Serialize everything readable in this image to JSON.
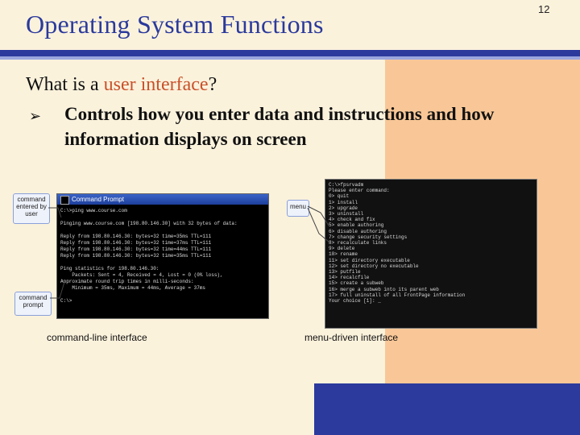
{
  "slide": {
    "title": "Operating System Functions",
    "page_number": "12",
    "question_prefix": "What is a ",
    "question_highlight": "user interface",
    "question_suffix": "?",
    "bullet_marker": "➢",
    "bullet_text": "Controls how you enter data and instructions and how information displays on screen"
  },
  "figures": {
    "command_line": {
      "window_title": "Command Prompt",
      "lines": [
        "C:\\>ping www.course.com",
        "",
        "Pinging www.course.com [198.80.146.30] with 32 bytes of data:",
        "",
        "Reply from 198.80.146.30: bytes=32 time=35ms TTL=111",
        "Reply from 198.80.146.30: bytes=32 time=37ms TTL=111",
        "Reply from 198.80.146.30: bytes=32 time=44ms TTL=111",
        "Reply from 198.80.146.30: bytes=32 time=35ms TTL=111",
        "",
        "Ping statistics for 198.80.146.30:",
        "    Packets: Sent = 4, Received = 4, Lost = 0 (0% loss),",
        "Approximate round trip times in milli-seconds:",
        "    Minimum = 35ms, Maximum = 44ms, Average = 37ms",
        "",
        "C:\\>"
      ],
      "callout_entered": "command entered by user",
      "callout_prompt": "command prompt",
      "caption": "command-line interface"
    },
    "menu_driven": {
      "lines": [
        "C:\\>fpsrvadm",
        "Please enter command:",
        "0> quit",
        "1> install",
        "2> upgrade",
        "3> uninstall",
        "4> check and fix",
        "5> enable authoring",
        "6> disable authoring",
        "7> change security settings",
        "8> recalculate links",
        "9> delete",
        "10> rename",
        "11> set directory executable",
        "12> set directory no executable",
        "13> putfile",
        "14> recalcfile",
        "15> create a subweb",
        "16> merge a subweb into its parent web",
        "17> full uninstall of all FrontPage information",
        "Your choice [1]: _"
      ],
      "callout_menu": "menu",
      "caption": "menu-driven interface"
    }
  },
  "colors": {
    "background": "#fbf2dc",
    "accent_column": "#f9c797",
    "brand_blue": "#2b3a9c",
    "highlight": "#c8512a"
  }
}
